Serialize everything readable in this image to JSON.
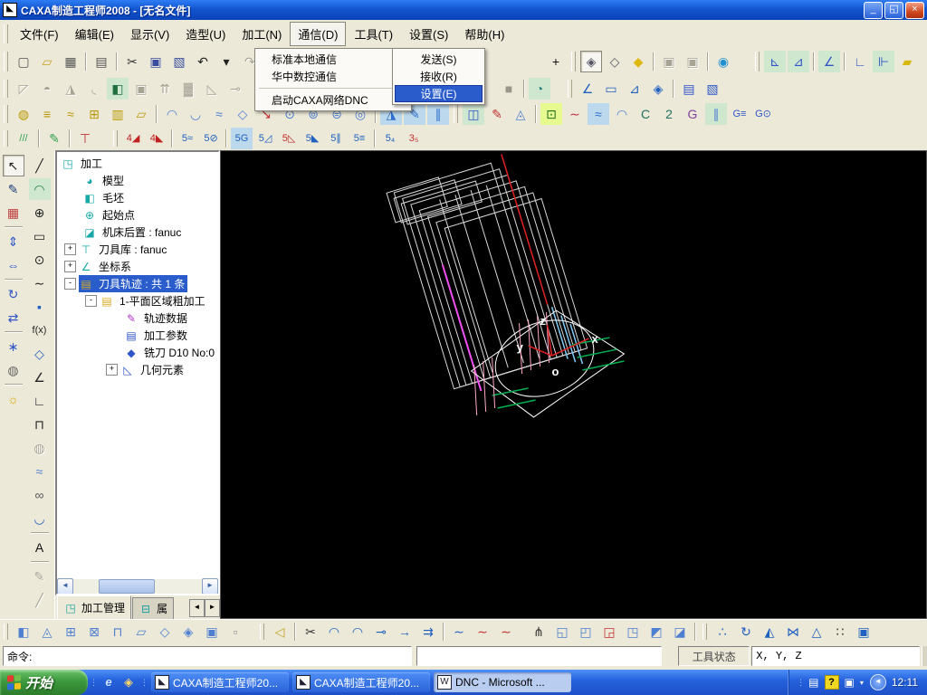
{
  "window": {
    "title": "CAXA制造工程师2008  -  [无名文件]",
    "minimize_glyph": "_",
    "restore_glyph": "◱",
    "close_glyph": "×"
  },
  "menubar": {
    "items": [
      {
        "name": "file",
        "label": "文件(F)"
      },
      {
        "name": "edit",
        "label": "编辑(E)"
      },
      {
        "name": "view",
        "label": "显示(V)"
      },
      {
        "name": "model",
        "label": "造型(U)"
      },
      {
        "name": "machining",
        "label": "加工(N)"
      },
      {
        "name": "comm",
        "label": "通信(D)",
        "open": true
      },
      {
        "name": "tools",
        "label": "工具(T)"
      },
      {
        "name": "settings",
        "label": "设置(S)"
      },
      {
        "name": "help",
        "label": "帮助(H)"
      }
    ]
  },
  "comm_menu": {
    "items": [
      {
        "name": "std-local-comm",
        "label": "标准本地通信",
        "arrow": true
      },
      {
        "name": "huazhong-nc-comm",
        "label": "华中数控通信",
        "arrow": true
      },
      {
        "sep": true
      },
      {
        "name": "start-caxa-dnc",
        "label": "启动CAXA网络DNC"
      }
    ],
    "submenu": [
      {
        "name": "send",
        "label": "发送(S)"
      },
      {
        "name": "receive",
        "label": "接收(R)"
      },
      {
        "name": "comm-settings",
        "label": "设置(E)",
        "hl": true
      }
    ]
  },
  "toolbars": {
    "row1": [
      {
        "grip": 1
      },
      {
        "name": "new-file",
        "g": "▢",
        "c": "#555555"
      },
      {
        "name": "open-file",
        "g": "▱",
        "c": "#c8a020"
      },
      {
        "name": "save-file",
        "g": "▦",
        "c": "#555555"
      },
      {
        "sep": 1
      },
      {
        "name": "print",
        "g": "▤",
        "c": "#555555"
      },
      {
        "sep": 1
      },
      {
        "name": "cut",
        "g": "✂",
        "c": "#333333"
      },
      {
        "name": "copy",
        "g": "▣",
        "c": "#3a4da0"
      },
      {
        "name": "paste",
        "g": "▧",
        "c": "#3a4da0"
      },
      {
        "name": "undo",
        "g": "↶",
        "c": "#222222"
      },
      {
        "name": "undo-more",
        "g": "▾",
        "c": "#222222"
      },
      {
        "name": "redo",
        "g": "↷",
        "grayed": 1
      },
      {
        "name": "redo-more",
        "g": "▾",
        "grayed": 1
      },
      {
        "sep": 1
      },
      {
        "name": "bulb",
        "g": "☼",
        "c": "#d8a800"
      },
      {
        "sp": 252
      },
      {
        "name": "pan-view",
        "g": "+",
        "c": "#111111"
      },
      {
        "grip": 1
      },
      {
        "name": "shaded-view",
        "g": "◈",
        "c": "#555566",
        "pressed": 1
      },
      {
        "name": "wireframe-view",
        "g": "◇",
        "c": "#555566"
      },
      {
        "name": "solid-view",
        "g": "◆",
        "c": "#ddb810"
      },
      {
        "sep": 1
      },
      {
        "name": "prev-view",
        "g": "▣",
        "grayed": 1
      },
      {
        "name": "next-view",
        "g": "▣",
        "grayed": 1
      },
      {
        "sep": 1
      },
      {
        "name": "zoom-telescope",
        "g": "◉",
        "c": "#2090d0"
      },
      {
        "sp": 18
      },
      {
        "grip": 1
      },
      {
        "name": "coord-origin",
        "g": "⊾",
        "c": "#2f55c8",
        "bg": "#cfe6cf"
      },
      {
        "name": "coord-rotate",
        "g": "⊿",
        "c": "#2f55c8",
        "bg": "#cfe6cf"
      },
      {
        "sep": 1
      },
      {
        "name": "coord-view",
        "g": "∠",
        "c": "#2f55c8",
        "bg": "#cfe6cf"
      },
      {
        "sep": 1
      },
      {
        "name": "coord-axis",
        "g": "∟",
        "c": "#2f55c8"
      },
      {
        "name": "coord-lines",
        "g": "⊩",
        "c": "#2f55c8",
        "bg": "#cfe6cf"
      },
      {
        "name": "coord-plane",
        "g": "▰",
        "c": "#d8b810"
      }
    ],
    "row2": [
      {
        "grip": 1
      },
      {
        "name": "gray-tool-1",
        "g": "◸",
        "grayed": 1
      },
      {
        "name": "gray-tool-2",
        "g": "◓",
        "grayed": 1
      },
      {
        "name": "gray-tool-3",
        "g": "◮",
        "grayed": 1
      },
      {
        "name": "gray-tool-4",
        "g": "◟",
        "grayed": 1
      },
      {
        "name": "trajectory-manage",
        "g": "◧",
        "c": "#207040",
        "bg": "#cfe6cf"
      },
      {
        "name": "gray-tool-5",
        "g": "▣",
        "grayed": 1
      },
      {
        "name": "gray-tool-6",
        "g": "⇈",
        "grayed": 1
      },
      {
        "name": "gray-tool-7",
        "g": "▓",
        "grayed": 1
      },
      {
        "name": "gray-tool-8",
        "g": "◺",
        "grayed": 1
      },
      {
        "name": "gray-tool-9",
        "g": "⊸",
        "grayed": 1
      },
      {
        "name": "gray-tool-10",
        "g": "◈",
        "grayed": 1
      },
      {
        "sp": 250
      },
      {
        "name": "gray-square",
        "g": "■",
        "c": "#9a968a"
      },
      {
        "sep": 1
      },
      {
        "name": "rotate-entity",
        "g": "◔",
        "c": "#208080",
        "bg": "#cfe6cf"
      },
      {
        "sp": 14
      },
      {
        "grip": 1
      },
      {
        "name": "measure-coord",
        "g": "∠",
        "c": "#2060c0"
      },
      {
        "name": "measure-distance",
        "g": "▭",
        "c": "#2060c0"
      },
      {
        "name": "measure-angle",
        "g": "⊿",
        "c": "#2060c0"
      },
      {
        "name": "measure-entity",
        "g": "◈",
        "c": "#2060c0"
      },
      {
        "sep": 1
      },
      {
        "name": "query-list",
        "g": "▤",
        "c": "#2f55c8"
      },
      {
        "name": "query-result",
        "g": "▧",
        "c": "#2f55c8"
      }
    ],
    "row3": [
      {
        "grip": 1
      },
      {
        "name": "mill-flat",
        "g": "◍",
        "c": "#b89800"
      },
      {
        "name": "mill-layers",
        "g": "≡",
        "c": "#b89800"
      },
      {
        "name": "mill-contour",
        "g": "≈",
        "c": "#b89800"
      },
      {
        "name": "mill-grid",
        "g": "⊞",
        "c": "#b89800"
      },
      {
        "name": "mill-steps",
        "g": "▥",
        "c": "#b89800"
      },
      {
        "name": "mill-pocket",
        "g": "▱",
        "c": "#b89800"
      },
      {
        "sep": 1
      },
      {
        "name": "surface-rough-1",
        "g": "◠",
        "c": "#4f7fd0"
      },
      {
        "name": "surface-rough-2",
        "g": "◡",
        "c": "#4f7fd0"
      },
      {
        "name": "surface-rough-3",
        "g": "≈",
        "c": "#4f7fd0"
      },
      {
        "name": "surface-rough-4",
        "g": "◇",
        "c": "#4f7fd0"
      },
      {
        "name": "surface-guide",
        "g": "↘",
        "c": "#c03030"
      },
      {
        "name": "surface-rough-5",
        "g": "⊙",
        "c": "#4f7fd0"
      },
      {
        "name": "surface-rough-6",
        "g": "⊚",
        "c": "#4f7fd0"
      },
      {
        "name": "surface-rough-7",
        "g": "⊜",
        "c": "#4f7fd0"
      },
      {
        "name": "surface-rough-8",
        "g": "◎",
        "c": "#4f7fd0"
      },
      {
        "sep": 1
      },
      {
        "name": "trim-1",
        "g": "◮",
        "c": "#2f6fd0",
        "bg": "#bcd8ec"
      },
      {
        "name": "trim-2",
        "g": "✎",
        "c": "#2f6fd0",
        "bg": "#bcd8ec"
      },
      {
        "name": "trim-3",
        "g": "∥",
        "c": "#2f6fd0",
        "bg": "#bcd8ec"
      },
      {
        "grip": 1
      },
      {
        "name": "model-mill",
        "g": "◫",
        "c": "#2f55c8",
        "bg": "#cfe6cf"
      },
      {
        "name": "trace-pen",
        "g": "✎",
        "c": "#c03030"
      },
      {
        "name": "mill-blue",
        "g": "◬",
        "c": "#4f7fd0"
      },
      {
        "sep": 1
      },
      {
        "name": "pocket-grid",
        "g": "⊡",
        "c": "#207020",
        "bg": "#e6fa90"
      },
      {
        "name": "curve-red",
        "g": "∼",
        "c": "#c03040"
      },
      {
        "name": "fan-lines",
        "g": "≈",
        "c": "#2f6fd0",
        "bg": "#bcd8ec"
      },
      {
        "name": "fan-surface",
        "g": "◠",
        "c": "#4f7fd0"
      },
      {
        "name": "c-mill",
        "g": "C",
        "c": "#207060"
      },
      {
        "name": "machine-sim",
        "g": "2",
        "c": "#207060"
      },
      {
        "name": "g01-check",
        "g": "G",
        "c": "#8040a0"
      },
      {
        "name": "v-lines",
        "g": "∥",
        "c": "#4f7fd0",
        "bg": "#cfe6cf"
      },
      {
        "name": "gcode-list",
        "g": "G≡",
        "c": "#2f55c8"
      },
      {
        "name": "gcode-gen",
        "g": "G⊙",
        "c": "#2f55c8"
      }
    ],
    "row4": [
      {
        "grip": 1
      },
      {
        "name": "hatch-display",
        "g": "///",
        "c": "#30a050"
      },
      {
        "sep": 1
      },
      {
        "name": "pick-green",
        "g": "✎",
        "c": "#30a050"
      },
      {
        "sep": 1
      },
      {
        "name": "tool-display",
        "g": "⊤",
        "c": "#c03030"
      },
      {
        "sp": 14
      },
      {
        "grip": 1
      },
      {
        "name": "four-axis-1",
        "g": "4◢",
        "c": "#c02020"
      },
      {
        "name": "four-axis-2",
        "g": "4◣",
        "c": "#c02020"
      },
      {
        "sep": 1
      },
      {
        "name": "five-axis-1",
        "g": "5≈",
        "c": "#2060c0"
      },
      {
        "name": "five-axis-2",
        "g": "5⊘",
        "c": "#2060c0"
      },
      {
        "sep": 1
      },
      {
        "name": "five-axis-g",
        "g": "5G",
        "c": "#2060c0",
        "bg": "#bcd8ec"
      },
      {
        "name": "five-axis-3",
        "g": "5◿",
        "c": "#2060c0"
      },
      {
        "name": "five-axis-4",
        "g": "5◺",
        "c": "#c03030"
      },
      {
        "name": "five-axis-5",
        "g": "5◣",
        "c": "#2060c0"
      },
      {
        "name": "five-axis-6",
        "g": "5∥",
        "c": "#2060c0"
      },
      {
        "name": "five-axis-7",
        "g": "5≡",
        "c": "#2060c0"
      },
      {
        "sep": 1
      },
      {
        "name": "five-to-four",
        "g": "5₄",
        "c": "#2060c0"
      },
      {
        "name": "three-to-five",
        "g": "3₅",
        "c": "#c03030"
      }
    ]
  },
  "left_toolbar": {
    "col1": [
      {
        "name": "select-cursor",
        "g": "↖",
        "c": "#222222",
        "pressed": 1
      },
      {
        "name": "sketch-edit",
        "g": "✎",
        "c": "#204080"
      },
      {
        "name": "layer-settings",
        "g": "▦",
        "c": "#c04040"
      },
      {
        "sep": 1
      },
      {
        "name": "stretch-v",
        "g": "⇕",
        "c": "#2f55c8"
      },
      {
        "name": "stretch-h",
        "g": "⇔",
        "c": "#2f55c8"
      },
      {
        "sep": 1
      },
      {
        "name": "rotate-copy",
        "g": "↻",
        "c": "#2f55c8"
      },
      {
        "name": "mirror-copy",
        "g": "⇄",
        "c": "#2f55c8"
      },
      {
        "sep": 1
      },
      {
        "name": "snap-settings",
        "g": "∗",
        "c": "#2f55c8"
      },
      {
        "name": "render-settings",
        "g": "◍",
        "c": "#666666"
      },
      {
        "sep": 1
      },
      {
        "name": "light-toggle",
        "g": "☼",
        "c": "#d8a800"
      }
    ],
    "col2": [
      {
        "name": "line-tool",
        "g": "╱",
        "c": "#222222"
      },
      {
        "name": "arc-tool",
        "g": "◠",
        "c": "#208040",
        "bg": "#cfe6cf"
      },
      {
        "name": "circle-tool",
        "g": "⊕",
        "c": "#222222"
      },
      {
        "name": "rectangle-tool",
        "g": "▭",
        "c": "#222222"
      },
      {
        "name": "ellipse-tool",
        "g": "⊙",
        "c": "#222222"
      },
      {
        "name": "spline-tool",
        "g": "∼",
        "c": "#222222"
      },
      {
        "name": "point-tool",
        "g": "▪",
        "c": "#2060c0"
      },
      {
        "name": "formula-curve",
        "g": "f(x)",
        "c": "#222222"
      },
      {
        "name": "polygon-tool",
        "g": "◇",
        "c": "#2060c0"
      },
      {
        "name": "axis-tool",
        "g": "∠",
        "c": "#222222"
      },
      {
        "name": "corner-tool",
        "g": "∟",
        "c": "#222222"
      },
      {
        "name": "projection-tool",
        "g": "⊓",
        "c": "#222222"
      },
      {
        "name": "surface-teapot",
        "g": "◍",
        "grayed": 1
      },
      {
        "name": "surface-mesh",
        "g": "≈",
        "c": "#4f7fd0"
      },
      {
        "name": "surface-glasses",
        "g": "∞",
        "c": "#555555"
      },
      {
        "name": "surface-wave",
        "g": "◡",
        "c": "#2060c0"
      },
      {
        "sep": 1
      },
      {
        "name": "text-tool",
        "g": "A",
        "c": "#111111"
      },
      {
        "sep": 1
      },
      {
        "name": "dim-tool-1",
        "g": "✎",
        "grayed": 1
      },
      {
        "name": "dim-tool-2",
        "g": "╱",
        "grayed": 1
      },
      {
        "name": "dim-tool-3",
        "g": "◿",
        "grayed": 1
      },
      {
        "sep": 1
      },
      {
        "name": "box-tool",
        "g": "⊔",
        "grayed": 1
      }
    ]
  },
  "bottom_toolbar": [
    {
      "grip": 1
    },
    {
      "name": "surface-stretch",
      "g": "◧",
      "c": "#4f7fd0"
    },
    {
      "name": "surface-rotate",
      "g": "◬",
      "c": "#4f7fd0"
    },
    {
      "name": "surface-plane-1",
      "g": "⊞",
      "c": "#4f7fd0"
    },
    {
      "name": "surface-plane-2",
      "g": "⊠",
      "c": "#4f7fd0"
    },
    {
      "name": "surface-frame",
      "g": "⊓",
      "c": "#4f7fd0"
    },
    {
      "name": "surface-para",
      "g": "▱",
      "c": "#4f7fd0"
    },
    {
      "name": "surface-face",
      "g": "◇",
      "c": "#4f7fd0"
    },
    {
      "name": "surface-sheet",
      "g": "◈",
      "c": "#4f7fd0"
    },
    {
      "name": "surface-sheets",
      "g": "▣",
      "c": "#4f7fd0"
    },
    {
      "name": "surface-box",
      "g": "▫",
      "c": "#888888"
    },
    {
      "sp": 10
    },
    {
      "grip": 1
    },
    {
      "name": "eraser",
      "g": "◁",
      "c": "#c0a020"
    },
    {
      "sep": 1
    },
    {
      "name": "curve-trim",
      "g": "✂",
      "c": "#333333"
    },
    {
      "name": "fillet-1",
      "g": "◠",
      "c": "#2060c0"
    },
    {
      "name": "fillet-2",
      "g": "◠",
      "c": "#2060c0"
    },
    {
      "name": "chain-1",
      "g": "⊸",
      "c": "#2060c0"
    },
    {
      "name": "chain-2",
      "g": "→",
      "c": "#2060c0"
    },
    {
      "name": "chain-3",
      "g": "⇉",
      "c": "#2060c0"
    },
    {
      "sep": 1
    },
    {
      "name": "curve-fit-1",
      "g": "∼",
      "c": "#2060c0"
    },
    {
      "name": "curve-fit-2",
      "g": "∼",
      "c": "#c03030"
    },
    {
      "name": "curve-fit-3",
      "g": "∼",
      "c": "#c03030"
    },
    {
      "sp": 10
    },
    {
      "name": "tripod-trim",
      "g": "⋔",
      "c": "#333333"
    },
    {
      "name": "sheet-fold-1",
      "g": "◱",
      "c": "#4f7fd0"
    },
    {
      "name": "sheet-fold-2",
      "g": "◰",
      "c": "#4f7fd0"
    },
    {
      "name": "sheet-fold-3",
      "g": "◲",
      "c": "#c03030"
    },
    {
      "name": "sheet-fold-4",
      "g": "◳",
      "c": "#4f7fd0"
    },
    {
      "name": "sheet-fold-5",
      "g": "◩",
      "c": "#4f7fd0"
    },
    {
      "name": "sheet-fold-6",
      "g": "◪",
      "c": "#4f7fd0"
    },
    {
      "sep": 1
    },
    {
      "grip": 1
    },
    {
      "name": "point-array",
      "g": "∴",
      "c": "#2060c0"
    },
    {
      "name": "rotate-axis",
      "g": "↻",
      "c": "#2060c0"
    },
    {
      "name": "cone-dashed",
      "g": "◭",
      "c": "#2060c0"
    },
    {
      "name": "mirror-entity",
      "g": "⋈",
      "c": "#2060c0"
    },
    {
      "name": "bell-entity",
      "g": "△",
      "c": "#2060c0"
    },
    {
      "name": "array-grid",
      "g": "∷",
      "c": "#333333"
    },
    {
      "name": "array-copy",
      "g": "▣",
      "c": "#2060c0"
    }
  ],
  "tree": {
    "items": [
      {
        "label": "加工",
        "level": 0,
        "icon": "machining-root",
        "g": "◳",
        "c": "#18a8a8"
      },
      {
        "label": "模型",
        "level": 1,
        "icon": "model-node",
        "g": "◕",
        "c": "#18a8a8"
      },
      {
        "label": "毛坯",
        "level": 1,
        "icon": "blank-node",
        "g": "◧",
        "c": "#18a8a8"
      },
      {
        "label": "起始点",
        "level": 1,
        "icon": "start-point-node",
        "g": "⊕",
        "c": "#18a8a8"
      },
      {
        "label": "机床后置 : fanuc",
        "level": 1,
        "icon": "post-process-node",
        "g": "◪",
        "c": "#18a8a8"
      },
      {
        "label": "刀具库 : fanuc",
        "level": 1,
        "box": "+",
        "icon": "tool-library-node",
        "g": "⊤",
        "c": "#18a8a8"
      },
      {
        "label": "坐标系",
        "level": 1,
        "box": "+",
        "icon": "coordinate-node",
        "g": "∠",
        "c": "#18a8a8"
      },
      {
        "label": "刀具轨迹 : 共 1 条",
        "level": 1,
        "box": "-",
        "icon": "toolpath-folder",
        "g": "▤",
        "c": "#d8aa20",
        "sel": true
      },
      {
        "label": "1-平面区域粗加工",
        "level": 2,
        "box": "-",
        "icon": "plane-rough-folder",
        "g": "▤",
        "c": "#d8aa20"
      },
      {
        "label": "轨迹数据",
        "level": 3,
        "icon": "trajectory-data-node",
        "g": "✎",
        "c": "#b030c0"
      },
      {
        "label": "加工参数",
        "level": 3,
        "icon": "machining-params-node",
        "g": "▤",
        "c": "#2f55c8"
      },
      {
        "label": "铣刀 D10 No:0",
        "level": 3,
        "icon": "mill-tool-node",
        "g": "◆",
        "c": "#2f55c8"
      },
      {
        "label": "几何元素",
        "level": 3,
        "box": "+",
        "icon": "geometry-node",
        "g": "◺",
        "c": "#2f55c8"
      }
    ]
  },
  "tabs": {
    "tab1": "加工管理",
    "tab2": "属",
    "left_arrow": "◄",
    "right_arrow": "►"
  },
  "statusbar": {
    "command_label": "命令:",
    "message": "",
    "tool_state_label": "工具状态",
    "coord_label": "X, Y, Z"
  },
  "taskbar": {
    "start_label": "开始",
    "tasks": [
      {
        "name": "task-caxa-1",
        "label": "CAXA制造工程师20...",
        "icon": "◣"
      },
      {
        "name": "task-caxa-2",
        "label": "CAXA制造工程师20...",
        "icon": "◣"
      },
      {
        "name": "task-dnc-word",
        "label": "DNC - Microsoft ...",
        "icon": "W",
        "active": true
      }
    ],
    "time": "12:11"
  },
  "viewport": {
    "axis_x": "x",
    "axis_y": "y",
    "axis_z": "z",
    "origin": "o"
  }
}
